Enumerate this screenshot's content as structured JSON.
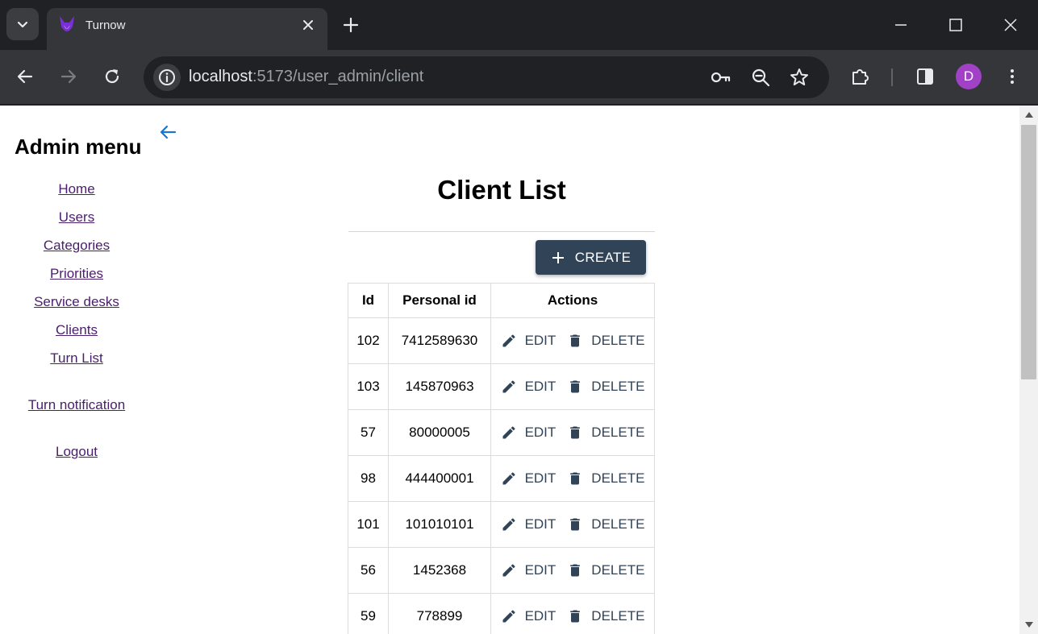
{
  "browser": {
    "tab_title": "Turnow",
    "url_host": "localhost",
    "url_rest": ":5173/user_admin/client",
    "profile_initial": "D",
    "profile_color": "#a142c6"
  },
  "sidebar": {
    "title": "Admin menu",
    "items": [
      {
        "label": "Home"
      },
      {
        "label": "Users"
      },
      {
        "label": "Categories"
      },
      {
        "label": "Priorities"
      },
      {
        "label": "Service desks"
      },
      {
        "label": "Clients"
      },
      {
        "label": "Turn List"
      },
      {
        "label": "Turn notification"
      },
      {
        "label": "Logout"
      }
    ]
  },
  "main": {
    "title": "Client List",
    "create_label": "CREATE",
    "columns": [
      "Id",
      "Personal id",
      "Actions"
    ],
    "edit_label": "EDIT",
    "delete_label": "DELETE",
    "rows": [
      {
        "id": "102",
        "personal_id": "7412589630"
      },
      {
        "id": "103",
        "personal_id": "145870963"
      },
      {
        "id": "57",
        "personal_id": "80000005"
      },
      {
        "id": "98",
        "personal_id": "444400001"
      },
      {
        "id": "101",
        "personal_id": "101010101"
      },
      {
        "id": "56",
        "personal_id": "1452368"
      },
      {
        "id": "59",
        "personal_id": "778899"
      }
    ]
  },
  "colors": {
    "primary": "#304357",
    "link": "#4a1d6e",
    "back_arrow": "#1976d2"
  },
  "icons": {
    "back": "arrow-left-icon",
    "create": "plus-icon",
    "edit": "pencil-icon",
    "delete": "trash-icon"
  }
}
